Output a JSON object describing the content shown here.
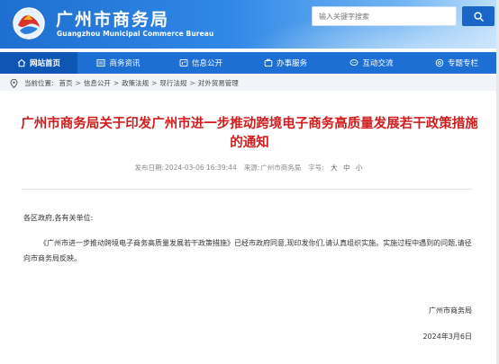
{
  "header": {
    "title": "广州市商务局",
    "subtitle": "Guangzhou Municipal Commerce Bureau",
    "search_placeholder": "输入关键字搜索"
  },
  "nav": {
    "items": [
      {
        "label": "网站首页",
        "icon": "home-icon"
      },
      {
        "label": "商务资讯",
        "icon": "news-icon"
      },
      {
        "label": "信息公开",
        "icon": "info-icon"
      },
      {
        "label": "办事服务",
        "icon": "service-icon"
      },
      {
        "label": "互动交流",
        "icon": "chat-icon"
      },
      {
        "label": "专题专栏",
        "icon": "topic-icon"
      }
    ]
  },
  "breadcrumb": {
    "prefix": "当前位置:",
    "items": [
      "首页",
      "信息公开",
      "政策法规",
      "现行法规",
      "对外贸易管理"
    ]
  },
  "article": {
    "title": "广州市商务局关于印发广州市进一步推动跨境电子商务高质量发展若干政策措施的通知",
    "meta": {
      "publish_label": "发布日期:",
      "publish_date": "2024-03-06 16:39:44",
      "source_label": "来源:",
      "source": "广州市商务局",
      "font_label": "字号:",
      "sizes": [
        "大",
        "中",
        "小"
      ]
    },
    "salutation": "各区政府,各有关单位:",
    "body": "《广州市进一步推动跨境电子商务高质量发展若干政策措施》已经市政府同意,现印发你们,请认真组织实施。实施过程中遇到的问题,请径向市商务局反映。",
    "signature": "广州市商务局",
    "date": "2024年3月6日"
  },
  "colors": {
    "nav_bg": "#1e6fd3",
    "nav_active": "#0f56b3",
    "title_red": "#d01d1d"
  }
}
